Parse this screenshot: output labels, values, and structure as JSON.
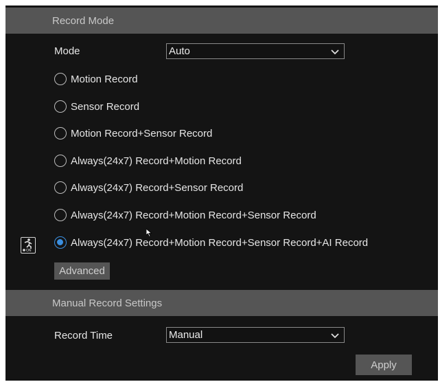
{
  "record_mode": {
    "header": "Record Mode",
    "mode_label": "Mode",
    "mode_value": "Auto",
    "options": [
      "Motion Record",
      "Sensor Record",
      "Motion Record+Sensor Record",
      "Always(24x7) Record+Motion Record",
      "Always(24x7) Record+Sensor Record",
      "Always(24x7) Record+Motion Record+Sensor Record",
      "Always(24x7) Record+Motion Record+Sensor Record+AI Record"
    ],
    "selected_index": 6,
    "advanced_label": "Advanced",
    "side_icon_text": "ON"
  },
  "manual": {
    "header": "Manual Record Settings",
    "record_time_label": "Record Time",
    "record_time_value": "Manual"
  },
  "footer": {
    "apply_label": "Apply"
  },
  "colors": {
    "background": "#141414",
    "header_bar": "#555555",
    "accent": "#3b8fe0"
  }
}
